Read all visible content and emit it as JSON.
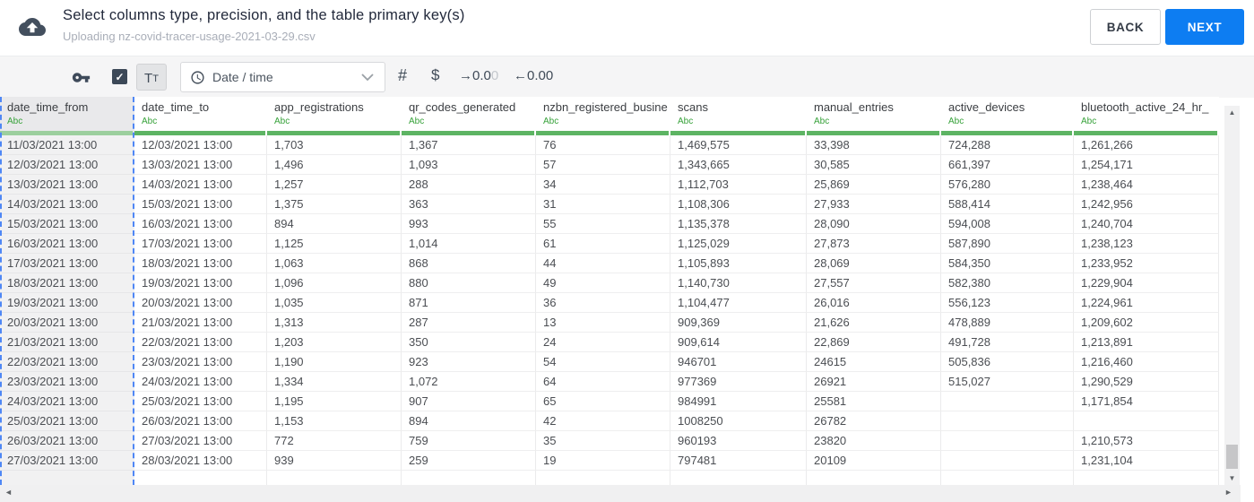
{
  "header": {
    "title": "Select columns type, precision, and the table primary key(s)",
    "subtitle": "Uploading nz-covid-tracer-usage-2021-03-29.csv",
    "back_label": "BACK",
    "next_label": "NEXT",
    "next_color": "#0d7df2"
  },
  "toolbar": {
    "key_icon": "primary-key-icon",
    "checkbox": {
      "checked": true,
      "check_glyph": "✓"
    },
    "text_type_button": {
      "large": "T",
      "small": "T"
    },
    "type_dropdown": {
      "value": "Date / time",
      "icon": "clock-icon"
    },
    "number_label": "#",
    "currency_label": "$",
    "decimal_left": {
      "arrow": "→",
      "main": "0.0",
      "faded": "0"
    },
    "decimal_right": {
      "arrow": "←",
      "value": "0.00"
    }
  },
  "table": {
    "type_badge": "Abc",
    "accent_green": "#5db463",
    "selected_column": "date_time_from",
    "columns": [
      {
        "name": "date_time_from",
        "type": "Abc",
        "selected": true
      },
      {
        "name": "date_time_to",
        "type": "Abc",
        "selected": false
      },
      {
        "name": "app_registrations",
        "type": "Abc",
        "selected": false
      },
      {
        "name": "qr_codes_generated",
        "type": "Abc",
        "selected": false
      },
      {
        "name": "nzbn_registered_busine",
        "type": "Abc",
        "selected": false
      },
      {
        "name": "scans",
        "type": "Abc",
        "selected": false
      },
      {
        "name": "manual_entries",
        "type": "Abc",
        "selected": false
      },
      {
        "name": "active_devices",
        "type": "Abc",
        "selected": false
      },
      {
        "name": "bluetooth_active_24_hr_",
        "type": "Abc",
        "selected": false
      }
    ],
    "rows": [
      [
        "11/03/2021 13:00",
        "12/03/2021 13:00",
        "1,703",
        "1,367",
        "76",
        "1,469,575",
        "33,398",
        "724,288",
        "1,261,266"
      ],
      [
        "12/03/2021 13:00",
        "13/03/2021 13:00",
        "1,496",
        "1,093",
        "57",
        "1,343,665",
        "30,585",
        "661,397",
        "1,254,171"
      ],
      [
        "13/03/2021 13:00",
        "14/03/2021 13:00",
        "1,257",
        "288",
        "34",
        "1,112,703",
        "25,869",
        "576,280",
        "1,238,464"
      ],
      [
        "14/03/2021 13:00",
        "15/03/2021 13:00",
        "1,375",
        "363",
        "31",
        "1,108,306",
        "27,933",
        "588,414",
        "1,242,956"
      ],
      [
        "15/03/2021 13:00",
        "16/03/2021 13:00",
        "894",
        "993",
        "55",
        "1,135,378",
        "28,090",
        "594,008",
        "1,240,704"
      ],
      [
        "16/03/2021 13:00",
        "17/03/2021 13:00",
        "1,125",
        "1,014",
        "61",
        "1,125,029",
        "27,873",
        "587,890",
        "1,238,123"
      ],
      [
        "17/03/2021 13:00",
        "18/03/2021 13:00",
        "1,063",
        "868",
        "44",
        "1,105,893",
        "28,069",
        "584,350",
        "1,233,952"
      ],
      [
        "18/03/2021 13:00",
        "19/03/2021 13:00",
        "1,096",
        "880",
        "49",
        "1,140,730",
        "27,557",
        "582,380",
        "1,229,904"
      ],
      [
        "19/03/2021 13:00",
        "20/03/2021 13:00",
        "1,035",
        "871",
        "36",
        "1,104,477",
        "26,016",
        "556,123",
        "1,224,961"
      ],
      [
        "20/03/2021 13:00",
        "21/03/2021 13:00",
        "1,313",
        "287",
        "13",
        "909,369",
        "21,626",
        "478,889",
        "1,209,602"
      ],
      [
        "21/03/2021 13:00",
        "22/03/2021 13:00",
        "1,203",
        "350",
        "24",
        "909,614",
        "22,869",
        "491,728",
        "1,213,891"
      ],
      [
        "22/03/2021 13:00",
        "23/03/2021 13:00",
        "1,190",
        "923",
        "54",
        "946701",
        "24615",
        "505,836",
        "1,216,460"
      ],
      [
        "23/03/2021 13:00",
        "24/03/2021 13:00",
        "1,334",
        "1,072",
        "64",
        "977369",
        "26921",
        "515,027",
        "1,290,529"
      ],
      [
        "24/03/2021 13:00",
        "25/03/2021 13:00",
        "1,195",
        "907",
        "65",
        "984991",
        "25581",
        "",
        "1,171,854"
      ],
      [
        "25/03/2021 13:00",
        "26/03/2021 13:00",
        "1,153",
        "894",
        "42",
        "1008250",
        "26782",
        "",
        ""
      ],
      [
        "26/03/2021 13:00",
        "27/03/2021 13:00",
        "772",
        "759",
        "35",
        "960193",
        "23820",
        "",
        "1,210,573"
      ],
      [
        "27/03/2021 13:00",
        "28/03/2021 13:00",
        "939",
        "259",
        "19",
        "797481",
        "20109",
        "",
        "1,231,104"
      ]
    ]
  },
  "scrollbars": {
    "v_up": "▲",
    "v_down": "▼",
    "h_left": "◄",
    "h_right": "►"
  }
}
